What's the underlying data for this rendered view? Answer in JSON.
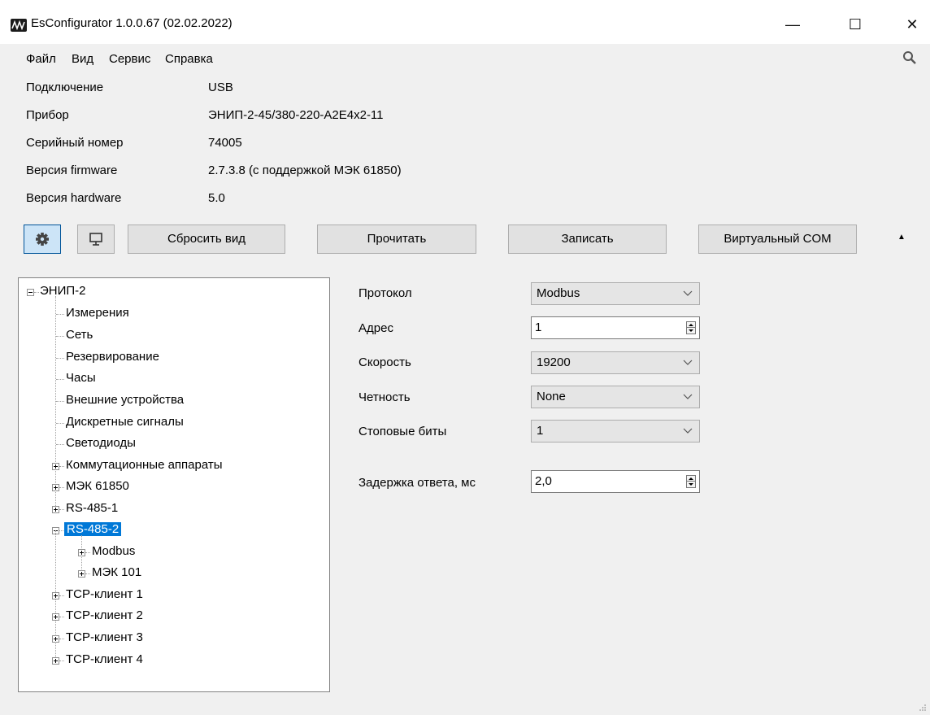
{
  "window": {
    "title": "EsConfigurator 1.0.0.67 (02.02.2022)",
    "minimize": "—",
    "maximize": "☐",
    "close": "✕"
  },
  "menu": {
    "file": "Файл",
    "view": "Вид",
    "service": "Сервис",
    "help": "Справка"
  },
  "info": {
    "connection_label": "Подключение",
    "connection_value": "USB",
    "device_label": "Прибор",
    "device_value": "ЭНИП-2-45/380-220-А2Е4х2-11",
    "serial_label": "Серийный номер",
    "serial_value": "74005",
    "firmware_label": "Версия firmware",
    "firmware_value": "2.7.3.8 (с поддержкой МЭК 61850)",
    "hardware_label": "Версия hardware",
    "hardware_value": "5.0"
  },
  "toolbar": {
    "reset_view": "Сбросить вид",
    "read": "Прочитать",
    "write": "Записать",
    "virtual_com": "Виртуальный COM",
    "collapse": "▲"
  },
  "tree": {
    "root": "ЭНИП-2",
    "items": [
      "Измерения",
      "Сеть",
      "Резервирование",
      "Часы",
      "Внешние устройства",
      "Дискретные сигналы",
      "Светодиоды",
      "Коммутационные аппараты",
      "МЭК 61850",
      "RS-485-1",
      "RS-485-2",
      "Modbus",
      "МЭК 101",
      "TCP-клиент 1",
      "TCP-клиент 2",
      "TCP-клиент 3",
      "TCP-клиент 4"
    ]
  },
  "form": {
    "protocol_label": "Протокол",
    "protocol_value": "Modbus",
    "address_label": "Адрес",
    "address_value": "1",
    "speed_label": "Скорость",
    "speed_value": "19200",
    "parity_label": "Четность",
    "parity_value": "None",
    "stopbits_label": "Стоповые биты",
    "stopbits_value": "1",
    "delay_label": "Задержка ответа, мс",
    "delay_value": "2,0"
  },
  "colors": {
    "selection": "#0078d7",
    "settings_button": "#cce4f7"
  }
}
